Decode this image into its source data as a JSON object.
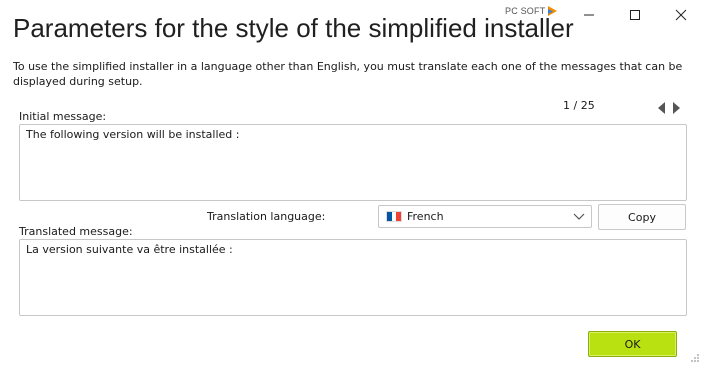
{
  "window": {
    "title": "Parameters for the style of the simplified installer",
    "brand": "PC SOFT",
    "controls": [
      "minimize-icon",
      "maximize-icon",
      "close-icon"
    ]
  },
  "description": "To use the simplified installer in a language other than English, you must translate each one of the messages that can be displayed during setup.",
  "navigation": {
    "counter": "1 / 25"
  },
  "initial": {
    "label": "Initial message:",
    "value": "The following version will be installed :"
  },
  "translation": {
    "language_label": "Translation language:",
    "language_value": "French",
    "copy_label": "Copy",
    "label": "Translated message:",
    "value": "La version suivante va être installée :"
  },
  "footer": {
    "ok_label": "OK"
  },
  "colors": {
    "ok_button": "#b9e011",
    "flag_blue": "#0055a4",
    "flag_white": "#ffffff",
    "flag_red": "#ef4135",
    "brand_accent": "#f28c00"
  }
}
